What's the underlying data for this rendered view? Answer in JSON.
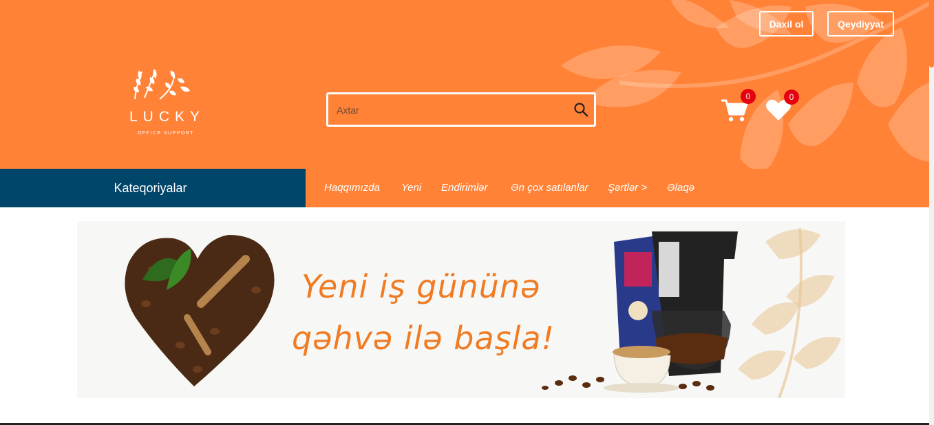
{
  "header": {
    "login_label": "Daxil ol",
    "register_label": "Qeydiyyat",
    "logo": {
      "name": "LUCKY",
      "tagline": "OFFICE SUPPORT"
    },
    "search": {
      "placeholder": "Axtar"
    },
    "cart": {
      "icon": "cart-icon",
      "count": "0"
    },
    "wishlist": {
      "icon": "heart-icon",
      "count": "0"
    }
  },
  "nav": {
    "categories_label": "Kateqoriyalar",
    "items": [
      {
        "label": "Haqqımızda"
      },
      {
        "label": "Yeni"
      },
      {
        "label": "Endirimlər"
      },
      {
        "label": "Ən çox satılanlar"
      },
      {
        "label": "Şərtlər >"
      },
      {
        "label": "Əlaqə"
      }
    ]
  },
  "banner": {
    "line1": "Yeni iş gününə",
    "line2": "qəhvə ilə başla!"
  },
  "colors": {
    "brand_orange": "#ff8237",
    "nav_blue": "#00456a",
    "badge_red": "#e3000f",
    "banner_text": "#f07b22"
  }
}
